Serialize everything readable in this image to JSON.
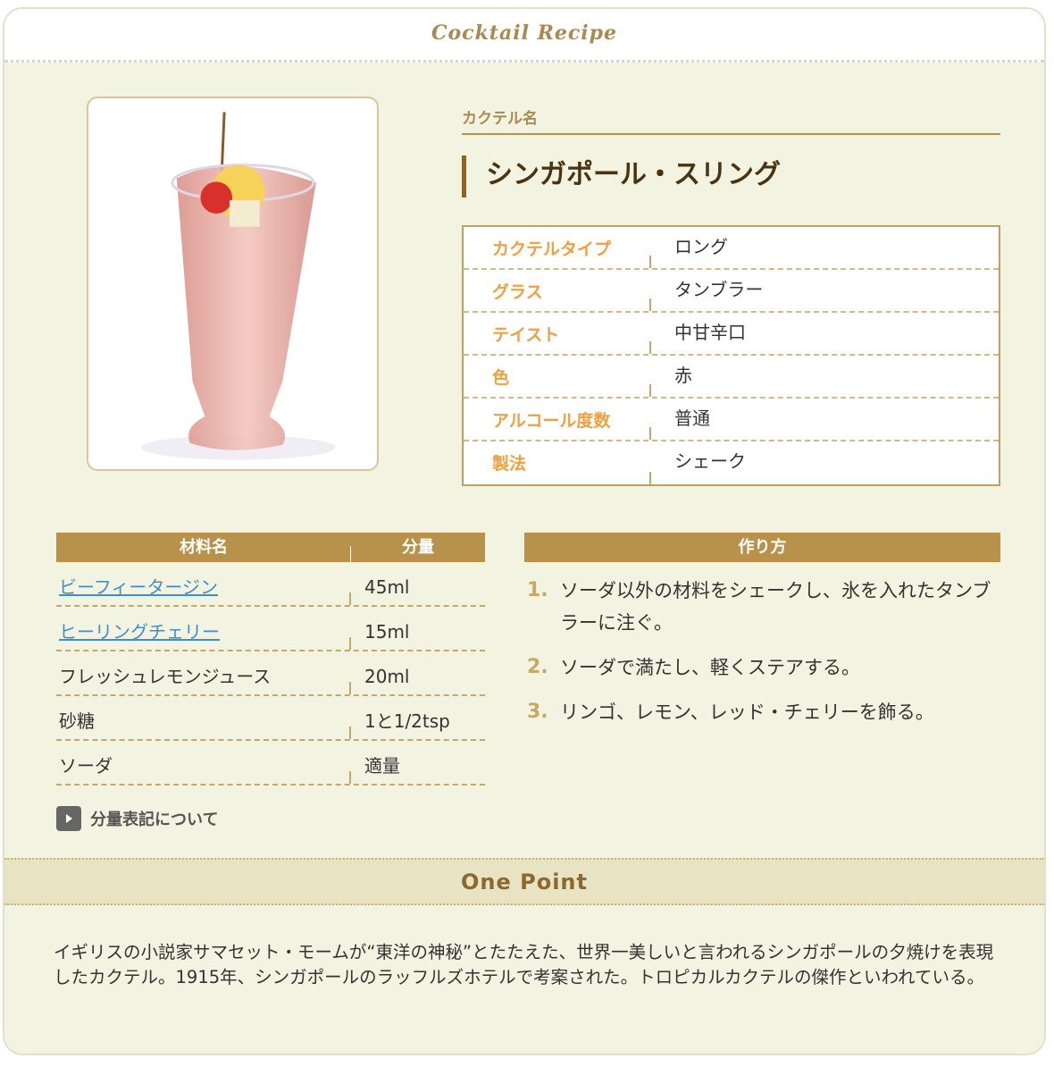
{
  "header": {
    "logo_text": "Cocktail Recipe"
  },
  "cocktail": {
    "name_label": "カクテル名",
    "name": "シンガポール・スリング",
    "specs": [
      {
        "label": "カクテルタイプ",
        "value": "ロング"
      },
      {
        "label": "グラス",
        "value": "タンブラー"
      },
      {
        "label": "テイスト",
        "value": "中甘辛口"
      },
      {
        "label": "色",
        "value": "赤"
      },
      {
        "label": "アルコール度数",
        "value": "普通"
      },
      {
        "label": "製法",
        "value": "シェーク"
      }
    ]
  },
  "ingredients": {
    "headers": {
      "name": "材料名",
      "amount": "分量"
    },
    "rows": [
      {
        "name": "ビーフィータージン",
        "amount": "45ml",
        "link": true
      },
      {
        "name": "ヒーリングチェリー",
        "amount": "15ml",
        "link": true
      },
      {
        "name": "フレッシュレモンジュース",
        "amount": "20ml",
        "link": false
      },
      {
        "name": "砂糖",
        "amount": "1と1/2tsp",
        "link": false
      },
      {
        "name": "ソーダ",
        "amount": "適量",
        "link": false
      }
    ],
    "note_link": "分量表記について"
  },
  "method": {
    "header": "作り方",
    "steps": [
      {
        "num": "1.",
        "text": "ソーダ以外の材料をシェークし、氷を入れたタンブラーに注ぐ。"
      },
      {
        "num": "2.",
        "text": "ソーダで満たし、軽くステアする。"
      },
      {
        "num": "3.",
        "text": "リンゴ、レモン、レッド・チェリーを飾る。"
      }
    ]
  },
  "one_point": {
    "title": "One Point",
    "text": "イギリスの小説家サマセット・モームが“東洋の神秘”とたたえた、世界一美しいと言われるシンガポールの夕焼けを表現したカクテル。1915年、シンガポールのラッフルズホテルで考案された。トロピカルカクテルの傑作といわれている。"
  },
  "colors": {
    "accent": "#b8924a",
    "background": "#f3f3e1",
    "spec_label": "#f0a040",
    "link": "#3d8fd0"
  }
}
